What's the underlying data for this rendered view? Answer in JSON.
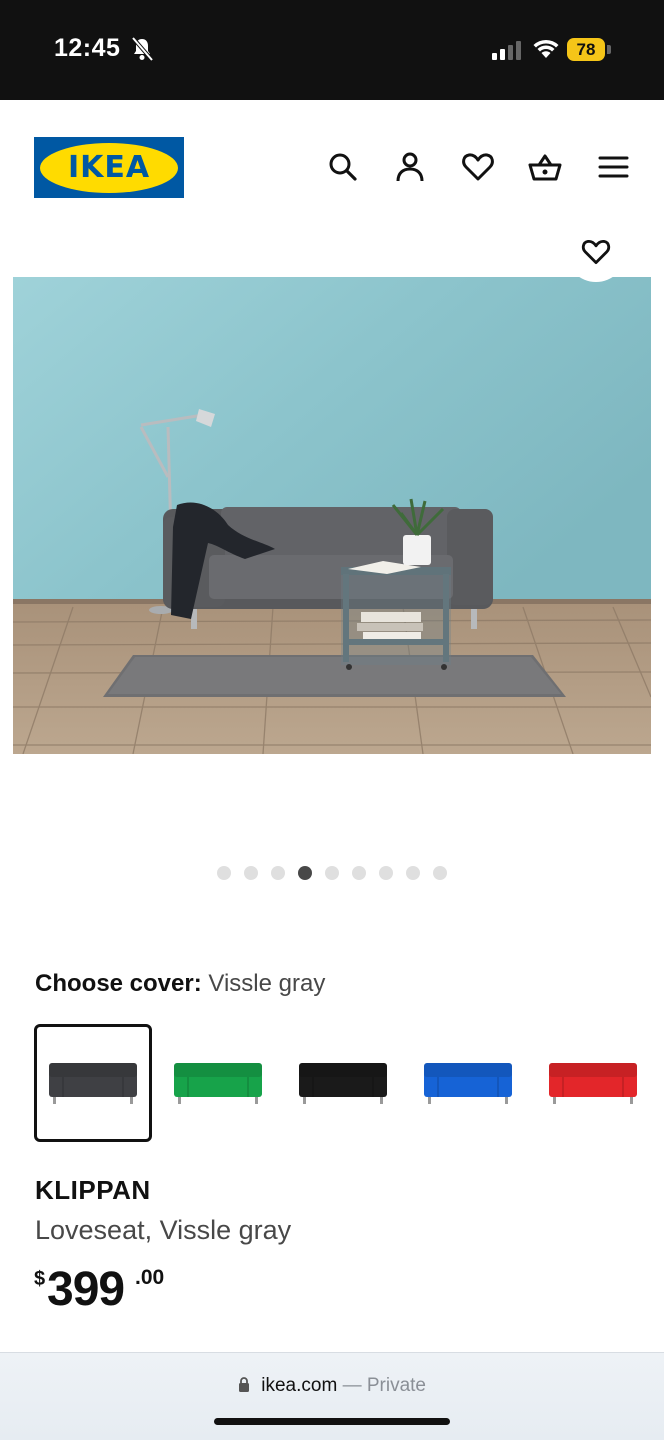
{
  "status_bar": {
    "time": "12:45",
    "battery": "78"
  },
  "header": {
    "logo_text": "IKEA",
    "icons": [
      "search-icon",
      "account-icon",
      "heart-icon",
      "cart-icon",
      "menu-icon"
    ]
  },
  "gallery": {
    "total_images": 9,
    "active_index": 3
  },
  "cover": {
    "label": "Choose cover:",
    "value": "Vissle gray",
    "swatches": [
      {
        "name": "Vissle gray",
        "color": "#3f4044",
        "selected": true
      },
      {
        "name": "green",
        "color": "#17a34a",
        "selected": false
      },
      {
        "name": "black",
        "color": "#1a1a1a",
        "selected": false
      },
      {
        "name": "blue",
        "color": "#1663d6",
        "selected": false
      },
      {
        "name": "red",
        "color": "#e3262a",
        "selected": false
      }
    ]
  },
  "product": {
    "name": "KLIPPAN",
    "description": "Loveseat, Vissle gray",
    "price_currency": "$",
    "price_whole": "399",
    "price_decimal": ".00"
  },
  "browser": {
    "domain": "ikea.com",
    "separator": "—",
    "mode": "Private"
  },
  "colors": {
    "ikea_blue": "#0058a3",
    "ikea_yellow": "#ffdb00",
    "wall": "#8fc7cf",
    "floor": "#b9a38b"
  }
}
